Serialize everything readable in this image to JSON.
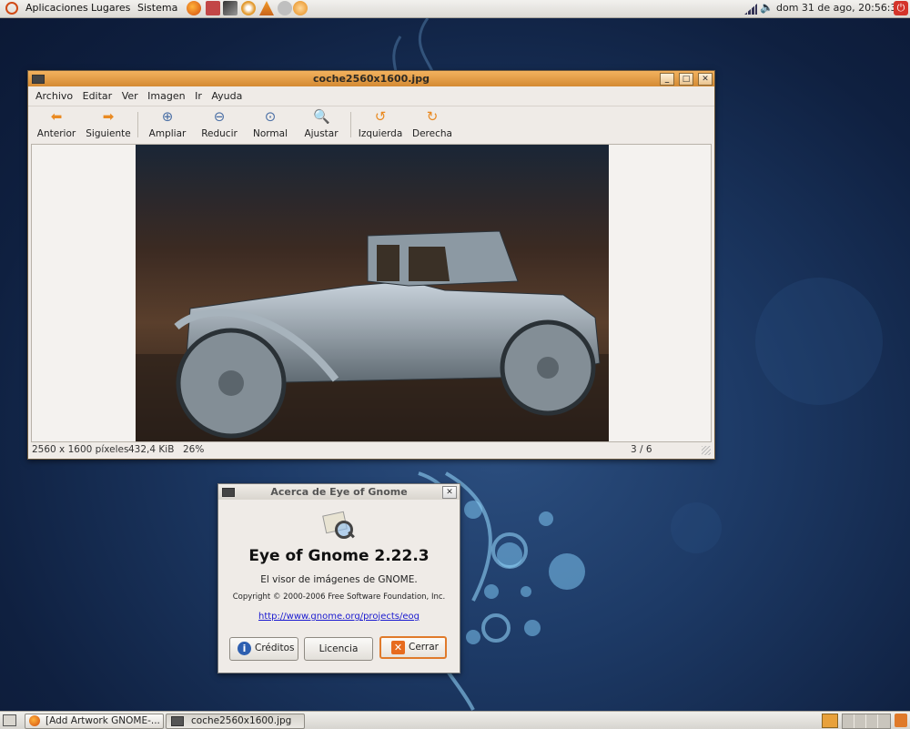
{
  "top_panel": {
    "menus": [
      "Aplicaciones",
      "Lugares",
      "Sistema"
    ],
    "clock": "dom 31 de ago, 20:56:37"
  },
  "viewer": {
    "title": "coche2560x1600.jpg",
    "menu": [
      "Archivo",
      "Editar",
      "Ver",
      "Imagen",
      "Ir",
      "Ayuda"
    ],
    "toolbar": [
      "Anterior",
      "Siguiente",
      "Ampliar",
      "Reducir",
      "Normal",
      "Ajustar",
      "Izquierda",
      "Derecha"
    ],
    "status": {
      "dimensions": "2560 x 1600 píxeles",
      "size": "432,4 KiB",
      "zoom": "26%",
      "position": "3 / 6"
    }
  },
  "about": {
    "title": "Acerca de Eye of Gnome",
    "app_name": "Eye of Gnome 2.22.3",
    "description": "El visor de imágenes de GNOME.",
    "copyright": "Copyright © 2000-2006 Free Software Foundation, Inc.",
    "link": "http://www.gnome.org/projects/eog",
    "buttons": {
      "credits": "Créditos",
      "license": "Licencia",
      "close": "Cerrar"
    }
  },
  "bottom_panel": {
    "tasks": [
      "[Add Artwork GNOME-...",
      "coche2560x1600.jpg"
    ]
  },
  "colors": {
    "titlebar": "#e09a45",
    "link": "#1a1ad0",
    "close_button_border": "#e07a2a"
  }
}
